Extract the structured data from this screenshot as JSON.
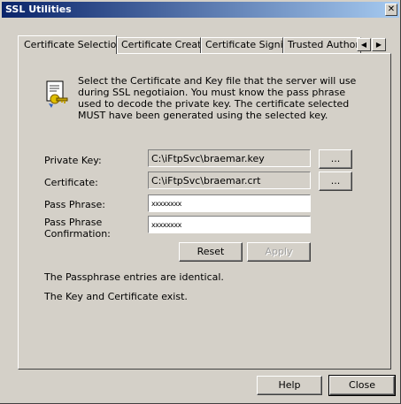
{
  "window": {
    "title": "SSL Utilities",
    "close_glyph": "✕"
  },
  "tabs": [
    {
      "label": "Certificate Selection"
    },
    {
      "label": "Certificate Creation"
    },
    {
      "label": "Certificate Signing"
    },
    {
      "label": "Trusted Authorities"
    }
  ],
  "tab_scroll": {
    "left": "◀",
    "right": "▶"
  },
  "info": {
    "icon": "certificate-key-icon",
    "text": "Select the Certificate and Key file that the server will use during SSL negotiaion. You must know the pass phrase used to decode the private key. The certificate selected MUST have been generated using the selected key."
  },
  "form": {
    "private_key_label": "Private Key:",
    "private_key_value": "C:\\iFtpSvc\\braemar.key",
    "certificate_label": "Certificate:",
    "certificate_value": "C:\\iFtpSvc\\braemar.crt",
    "browse_label": "...",
    "pass_phrase_label": "Pass Phrase:",
    "pass_phrase_value": "xxxxxxxx",
    "confirm_label": "Pass Phrase Confirmation:",
    "confirm_value": "xxxxxxxx",
    "reset_label": "Reset",
    "apply_label": "Apply"
  },
  "status": {
    "line1": "The Passphrase entries are identical.",
    "line2": "The Key and Certificate exist."
  },
  "footer": {
    "help_label": "Help",
    "close_label": "Close"
  },
  "colors": {
    "face": "#d4d0c8",
    "title_start": "#0a246a",
    "title_end": "#a6caf0"
  }
}
